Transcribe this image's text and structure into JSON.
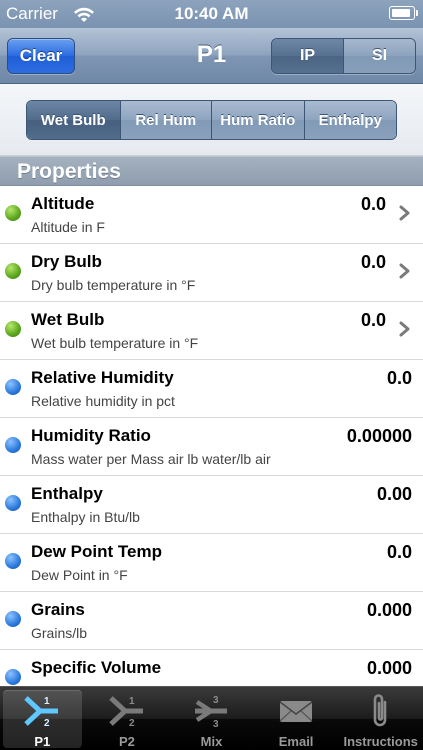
{
  "status_bar": {
    "carrier": "Carrier",
    "time": "10:40 AM"
  },
  "nav": {
    "clear_label": "Clear",
    "title": "P1",
    "units": [
      "IP",
      "SI"
    ],
    "selected_unit": "IP"
  },
  "mode_control": {
    "segments": [
      "Wet Bulb",
      "Rel Hum",
      "Hum Ratio",
      "Enthalpy"
    ],
    "selected": "Wet Bulb"
  },
  "section": {
    "title": "Properties"
  },
  "properties": [
    {
      "name": "Altitude",
      "desc": "Altitude in F",
      "value": "0.0",
      "status": "green",
      "editable": true
    },
    {
      "name": "Dry Bulb",
      "desc": "Dry bulb temperature in °F",
      "value": "0.0",
      "status": "green",
      "editable": true
    },
    {
      "name": "Wet Bulb",
      "desc": "Wet bulb temperature in  °F",
      "value": "0.0",
      "status": "green",
      "editable": true
    },
    {
      "name": "Relative Humidity",
      "desc": "Relative humidity in  pct",
      "value": "0.0",
      "status": "blue",
      "editable": false
    },
    {
      "name": "Humidity Ratio",
      "desc": "Mass water per Mass air lb water/lb air",
      "value": "0.00000",
      "status": "blue",
      "editable": false
    },
    {
      "name": "Enthalpy",
      "desc": "Enthalpy in  Btu/lb",
      "value": "0.00",
      "status": "blue",
      "editable": false
    },
    {
      "name": "Dew Point Temp",
      "desc": "Dew Point in  °F",
      "value": "0.0",
      "status": "blue",
      "editable": false
    },
    {
      "name": "Grains",
      "desc": "Grains/lb",
      "value": "0.000",
      "status": "blue",
      "editable": false
    },
    {
      "name": "Specific Volume",
      "desc": "",
      "value": "0.000",
      "status": "blue",
      "editable": false
    }
  ],
  "tab_bar": {
    "tabs": [
      {
        "label": "P1",
        "icon": "merge-1-2-icon",
        "num_top": "1",
        "num_bottom": "2"
      },
      {
        "label": "P2",
        "icon": "merge-1-2-icon",
        "num_top": "1",
        "num_bottom": "2"
      },
      {
        "label": "Mix",
        "icon": "mix-3-icon",
        "num_top": "3",
        "num_bottom": "3"
      },
      {
        "label": "Email",
        "icon": "envelope-icon"
      },
      {
        "label": "Instructions",
        "icon": "paperclip-icon"
      }
    ],
    "selected": "P1"
  },
  "colors": {
    "green_dot": "#5aa51d",
    "blue_dot": "#2a79dc",
    "clear_button": "#2a6ae0",
    "nav_bar": "#8ea4bf"
  }
}
